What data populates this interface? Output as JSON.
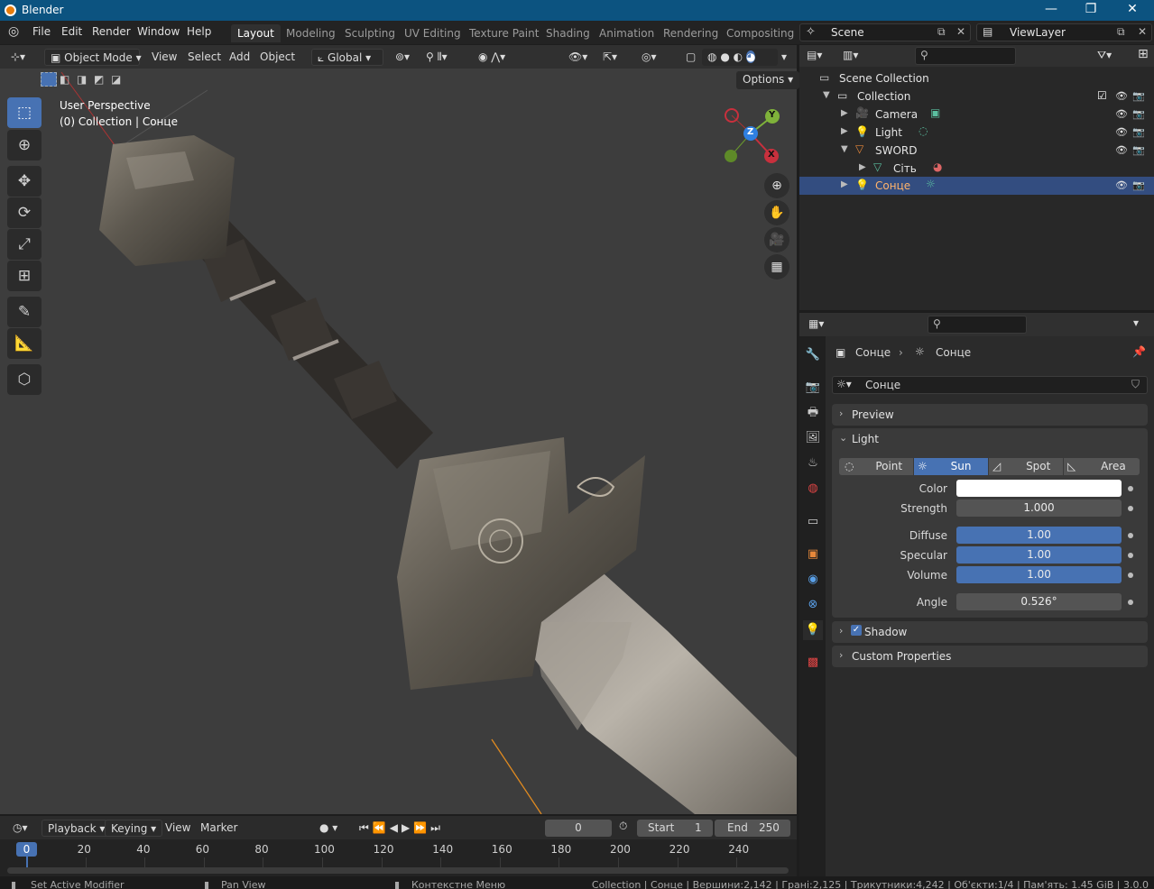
{
  "window": {
    "title": "Blender",
    "controls": [
      "—",
      "❐",
      "✕"
    ]
  },
  "menu": [
    "File",
    "Edit",
    "Render",
    "Window",
    "Help"
  ],
  "workspaces": [
    {
      "label": "Layout",
      "active": true
    },
    {
      "label": "Modeling"
    },
    {
      "label": "Sculpting"
    },
    {
      "label": "UV Editing"
    },
    {
      "label": "Texture Paint"
    },
    {
      "label": "Shading"
    },
    {
      "label": "Animation"
    },
    {
      "label": "Rendering"
    },
    {
      "label": "Compositing"
    }
  ],
  "scene": {
    "name": "Scene",
    "view_layer": "ViewLayer"
  },
  "viewport": {
    "mode": "Object Mode",
    "menus": [
      "View",
      "Select",
      "Add",
      "Object"
    ],
    "orientation": "Global",
    "options_label": "Options",
    "overlay_title": "User Perspective",
    "overlay_sub": "(0) Collection | Сонце",
    "gizmo_axes": {
      "x": "X",
      "y": "Y",
      "z": "Z"
    }
  },
  "outliner": {
    "root": "Scene Collection",
    "items": [
      {
        "label": "Collection"
      },
      {
        "label": "Camera"
      },
      {
        "label": "Light"
      },
      {
        "label": "SWORD"
      },
      {
        "label": "Сіть"
      },
      {
        "label": "Сонце",
        "selected": true
      }
    ]
  },
  "properties": {
    "breadcrumb_object": "Сонце",
    "breadcrumb_data": "Сонце",
    "datablock_name": "Сонце",
    "panels": {
      "preview": "Preview",
      "light": "Light",
      "shadow": "Shadow",
      "custom": "Custom Properties"
    },
    "light_types": [
      "Point",
      "Sun",
      "Spot",
      "Area"
    ],
    "active_type": "Sun",
    "fields": {
      "color": {
        "label": "Color",
        "value": "#ffffff"
      },
      "strength": {
        "label": "Strength",
        "value": "1.000"
      },
      "diffuse": {
        "label": "Diffuse",
        "value": "1.00"
      },
      "specular": {
        "label": "Specular",
        "value": "1.00"
      },
      "volume": {
        "label": "Volume",
        "value": "1.00"
      },
      "angle": {
        "label": "Angle",
        "value": "0.526°"
      }
    },
    "shadow_enabled": true
  },
  "timeline": {
    "menus": [
      "Playback",
      "Keying",
      "View",
      "Marker"
    ],
    "current_frame": "0",
    "start_label": "Start",
    "start": "1",
    "end_label": "End",
    "end": "250",
    "ruler": [
      "0",
      "20",
      "40",
      "60",
      "80",
      "100",
      "120",
      "140",
      "160",
      "180",
      "200",
      "220",
      "240"
    ]
  },
  "statusbar": {
    "left1": "Set Active Modifier",
    "left2": "Pan View",
    "left3": "Контекстне Меню",
    "right": "Collection | Сонце | Вершини:2,142 | Грані:2,125 | Трикутники:4,242 | Об'єкти:1/4 | Пам'ять: 1.45 GiB | 3.0.0"
  },
  "colors": {
    "accent": "#4772b3",
    "titlebar": "#0c5380",
    "selected_row": "#334d80"
  }
}
